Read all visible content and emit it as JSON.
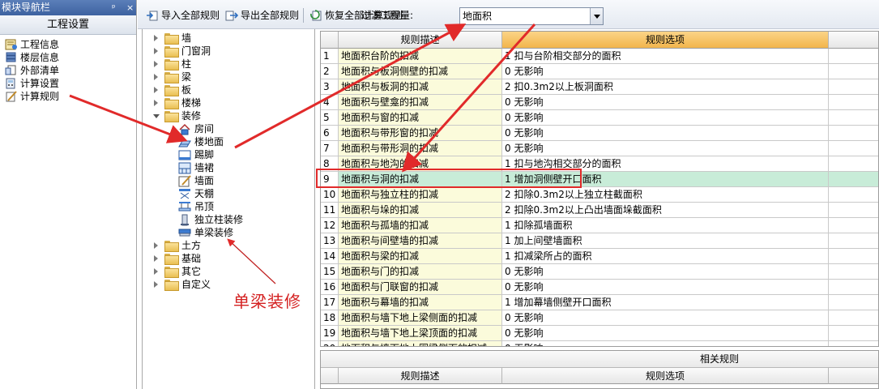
{
  "nav": {
    "title": "模块导航栏",
    "pin": "ᵖ",
    "close": "×",
    "header": "工程设置",
    "items": [
      {
        "label": "工程信息",
        "icon": "project-info-icon"
      },
      {
        "label": "楼层信息",
        "icon": "floor-info-icon"
      },
      {
        "label": "外部清单",
        "icon": "external-list-icon"
      },
      {
        "label": "计算设置",
        "icon": "calc-settings-icon"
      },
      {
        "label": "计算规则",
        "icon": "calc-rules-icon"
      }
    ]
  },
  "toolbar": {
    "import_label": "导入全部规则",
    "export_label": "导出全部规则",
    "restore_label": "恢复全部计算规则",
    "filter_label": "过滤工程量:",
    "filter_value": "地面积"
  },
  "tree": {
    "top": [
      "墙",
      "门窗洞",
      "柱",
      "梁",
      "板",
      "楼梯",
      "装修"
    ],
    "children": [
      {
        "label": "房间",
        "icon": "room-icon"
      },
      {
        "label": "楼地面",
        "icon": "floor-surface-icon"
      },
      {
        "label": "踢脚",
        "icon": "skirting-icon"
      },
      {
        "label": "墙裙",
        "icon": "wainscot-icon"
      },
      {
        "label": "墙面",
        "icon": "wall-surface-icon"
      },
      {
        "label": "天棚",
        "icon": "ceiling-icon"
      },
      {
        "label": "吊顶",
        "icon": "suspended-ceiling-icon"
      },
      {
        "label": "独立柱装修",
        "icon": "column-finish-icon"
      },
      {
        "label": "单梁装修",
        "icon": "beam-finish-icon"
      }
    ],
    "bottom": [
      "土方",
      "基础",
      "其它",
      "自定义"
    ]
  },
  "grid": {
    "col_desc": "规则描述",
    "col_opt": "规则选项",
    "rows": [
      {
        "n": "1",
        "desc": "地面积台阶的扣减",
        "opt": "1 扣与台阶相交部分的面积"
      },
      {
        "n": "2",
        "desc": "地面积与板洞侧壁的扣减",
        "opt": "0  无影响"
      },
      {
        "n": "3",
        "desc": "地面积与板洞的扣减",
        "opt": "2 扣0.3m2以上板洞面积"
      },
      {
        "n": "4",
        "desc": "地面积与壁龛的扣减",
        "opt": "0  无影响"
      },
      {
        "n": "5",
        "desc": "地面积与窗的扣减",
        "opt": "0  无影响"
      },
      {
        "n": "6",
        "desc": "地面积与带形窗的扣减",
        "opt": "0  无影响"
      },
      {
        "n": "7",
        "desc": "地面积与带形洞的扣减",
        "opt": "0  无影响"
      },
      {
        "n": "8",
        "desc": "地面积与地沟的扣减",
        "opt": "1 扣与地沟相交部分的面积"
      },
      {
        "n": "9",
        "desc": "地面积与洞的扣减",
        "opt": "1 增加洞侧壁开口面积"
      },
      {
        "n": "10",
        "desc": "地面积与独立柱的扣减",
        "opt": "2 扣除0.3m2以上独立柱截面积"
      },
      {
        "n": "11",
        "desc": "地面积与垛的扣减",
        "opt": "2 扣除0.3m2以上凸出墙面垛截面积"
      },
      {
        "n": "12",
        "desc": "地面积与孤墙的扣减",
        "opt": "1 扣除孤墙面积"
      },
      {
        "n": "13",
        "desc": "地面积与间壁墙的扣减",
        "opt": "1 加上间壁墙面积"
      },
      {
        "n": "14",
        "desc": "地面积与梁的扣减",
        "opt": "1 扣减梁所占的面积"
      },
      {
        "n": "15",
        "desc": "地面积与门的扣减",
        "opt": "0  无影响"
      },
      {
        "n": "16",
        "desc": "地面积与门联窗的扣减",
        "opt": "0  无影响"
      },
      {
        "n": "17",
        "desc": "地面积与幕墙的扣减",
        "opt": "1 增加幕墙侧壁开口面积"
      },
      {
        "n": "18",
        "desc": "地面积与墙下地上梁侧面的扣减",
        "opt": "0  无影响"
      },
      {
        "n": "19",
        "desc": "地面积与墙下地上梁顶面的扣减",
        "opt": "0  无影响"
      },
      {
        "n": "20",
        "desc": "地面积与墙下地上圈梁侧面的扣减",
        "opt": "0  无影响"
      }
    ]
  },
  "related": {
    "title": "相关规则",
    "col_desc": "规则描述",
    "col_opt": "规则选项"
  },
  "annotation": {
    "text": "单梁装修",
    "color": "#d42020"
  }
}
